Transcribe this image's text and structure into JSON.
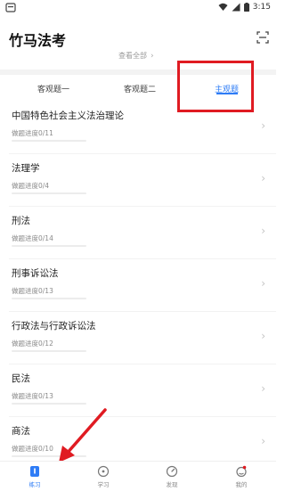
{
  "status_bar": {
    "time": "3:15"
  },
  "header": {
    "app_title": "竹马法考",
    "view_all_label": "查看全部",
    "view_all_chevron": "›"
  },
  "tabs": [
    {
      "label": "客观题一",
      "active": false
    },
    {
      "label": "客观题二",
      "active": false
    },
    {
      "label": "主观题",
      "active": true
    }
  ],
  "subjects": [
    {
      "name": "中国特色社会主义法治理论",
      "progress_text": "做题进度0/11",
      "progress": 0
    },
    {
      "name": "法理学",
      "progress_text": "做题进度0/4",
      "progress": 0
    },
    {
      "name": "刑法",
      "progress_text": "做题进度0/14",
      "progress": 0
    },
    {
      "name": "刑事诉讼法",
      "progress_text": "做题进度0/13",
      "progress": 0
    },
    {
      "name": "行政法与行政诉讼法",
      "progress_text": "做题进度0/12",
      "progress": 0
    },
    {
      "name": "民法",
      "progress_text": "做题进度0/13",
      "progress": 0
    },
    {
      "name": "商法",
      "progress_text": "做题进度0/10",
      "progress": 0
    }
  ],
  "bottom_nav": [
    {
      "label": "练习",
      "icon": "practice-icon",
      "active": true
    },
    {
      "label": "学习",
      "icon": "study-icon",
      "active": false
    },
    {
      "label": "发现",
      "icon": "discover-icon",
      "active": false
    },
    {
      "label": "我的",
      "icon": "profile-icon",
      "active": false
    }
  ],
  "colors": {
    "accent": "#2e7cf6",
    "annotation": "#e01b22"
  }
}
